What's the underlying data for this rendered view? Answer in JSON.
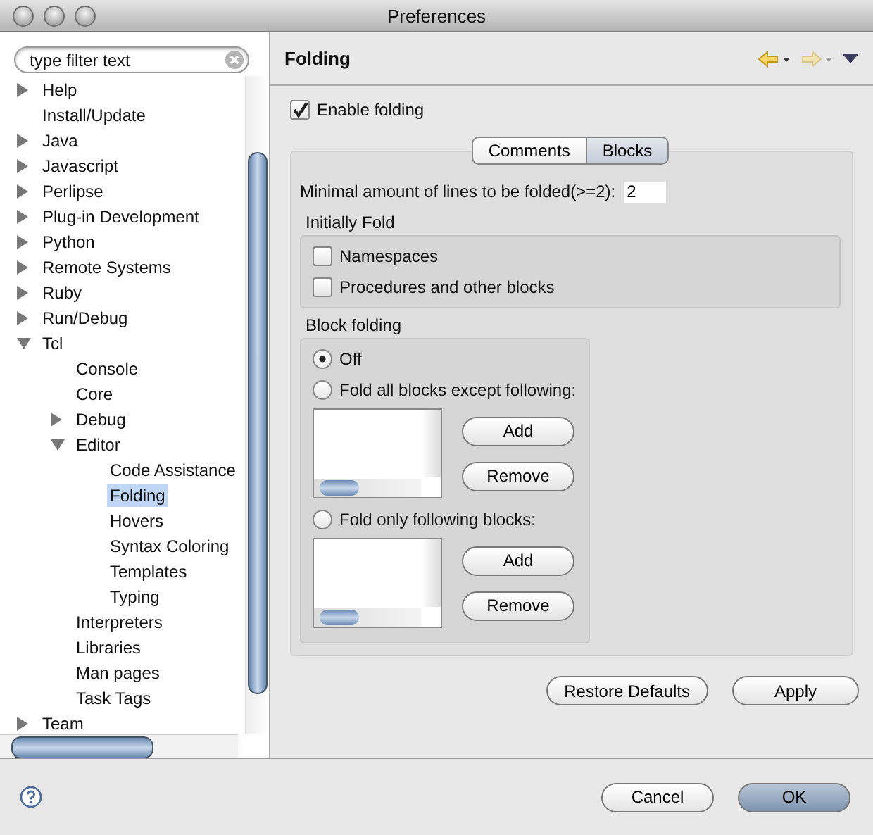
{
  "window": {
    "title": "Preferences"
  },
  "filter": {
    "placeholder": "type filter text"
  },
  "tree": [
    {
      "label": "Help",
      "expanded": false,
      "selected": false
    },
    {
      "label": "Install/Update",
      "selected": false
    },
    {
      "label": "Java",
      "expanded": false,
      "selected": false
    },
    {
      "label": "Javascript",
      "expanded": false,
      "selected": false
    },
    {
      "label": "Perlipse",
      "expanded": false,
      "selected": false
    },
    {
      "label": "Plug-in Development",
      "expanded": false,
      "selected": false
    },
    {
      "label": "Python",
      "expanded": false,
      "selected": false
    },
    {
      "label": "Remote Systems",
      "expanded": false,
      "selected": false
    },
    {
      "label": "Ruby",
      "expanded": false,
      "selected": false
    },
    {
      "label": "Run/Debug",
      "expanded": false,
      "selected": false
    },
    {
      "label": "Tcl",
      "expanded": true,
      "selected": false,
      "children": [
        {
          "label": "Console",
          "selected": false
        },
        {
          "label": "Core",
          "selected": false
        },
        {
          "label": "Debug",
          "expanded": false,
          "selected": false
        },
        {
          "label": "Editor",
          "expanded": true,
          "selected": false,
          "children": [
            {
              "label": "Code Assistance",
              "selected": false
            },
            {
              "label": "Folding",
              "selected": true
            },
            {
              "label": "Hovers",
              "selected": false
            },
            {
              "label": "Syntax Coloring",
              "selected": false
            },
            {
              "label": "Templates",
              "selected": false
            },
            {
              "label": "Typing",
              "selected": false
            }
          ]
        },
        {
          "label": "Interpreters",
          "selected": false
        },
        {
          "label": "Libraries",
          "selected": false
        },
        {
          "label": "Man pages",
          "selected": false
        },
        {
          "label": "Task Tags",
          "selected": false
        }
      ]
    },
    {
      "label": "Team",
      "expanded": false,
      "selected": false
    }
  ],
  "page": {
    "title": "Folding"
  },
  "enable_folding": {
    "label": "Enable folding",
    "checked": true
  },
  "tabs": [
    {
      "label": "Comments",
      "selected": false
    },
    {
      "label": "Blocks",
      "selected": true
    }
  ],
  "min_lines": {
    "label": "Minimal amount of lines to be folded(>=2):",
    "value": "2"
  },
  "initially_fold": {
    "title": "Initially Fold",
    "options": [
      {
        "label": "Namespaces",
        "checked": false
      },
      {
        "label": "Procedures and other blocks",
        "checked": false
      }
    ]
  },
  "block_folding": {
    "title": "Block folding",
    "options": [
      {
        "label": "Off",
        "selected": true
      },
      {
        "label": "Fold all blocks except following:",
        "selected": false,
        "buttons": [
          "Add",
          "Remove"
        ]
      },
      {
        "label": "Fold only following blocks:",
        "selected": false,
        "buttons": [
          "Add",
          "Remove"
        ]
      }
    ]
  },
  "page_buttons": [
    "Restore Defaults",
    "Apply"
  ],
  "dialog_buttons": [
    {
      "label": "Cancel",
      "default": false
    },
    {
      "label": "OK",
      "default": true
    }
  ]
}
